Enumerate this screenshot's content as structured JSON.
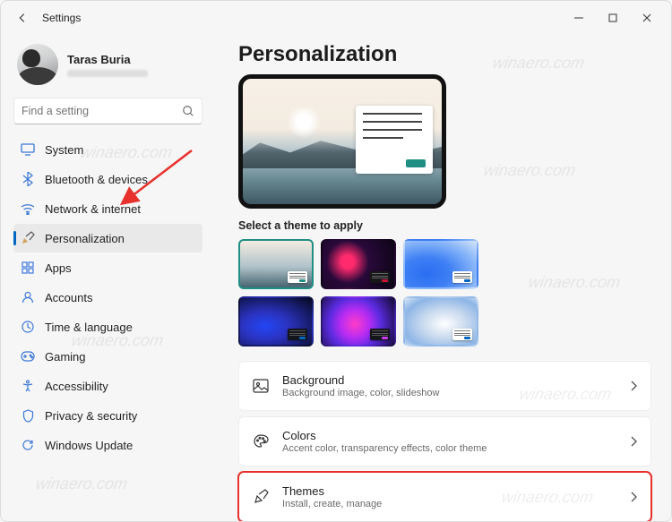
{
  "window": {
    "title": "Settings",
    "profile_name": "Taras Buria"
  },
  "search": {
    "placeholder": "Find a setting"
  },
  "nav": {
    "items": [
      {
        "id": "system",
        "label": "System"
      },
      {
        "id": "bluetooth",
        "label": "Bluetooth & devices"
      },
      {
        "id": "network",
        "label": "Network & internet"
      },
      {
        "id": "personalization",
        "label": "Personalization"
      },
      {
        "id": "apps",
        "label": "Apps"
      },
      {
        "id": "accounts",
        "label": "Accounts"
      },
      {
        "id": "time",
        "label": "Time & language"
      },
      {
        "id": "gaming",
        "label": "Gaming"
      },
      {
        "id": "accessibility",
        "label": "Accessibility"
      },
      {
        "id": "privacy",
        "label": "Privacy & security"
      },
      {
        "id": "update",
        "label": "Windows Update"
      }
    ]
  },
  "page": {
    "title": "Personalization",
    "theme_label": "Select a theme to apply"
  },
  "cards": {
    "background": {
      "title": "Background",
      "subtitle": "Background image, color, slideshow"
    },
    "colors": {
      "title": "Colors",
      "subtitle": "Accent color, transparency effects, color theme"
    },
    "themes": {
      "title": "Themes",
      "subtitle": "Install, create, manage"
    }
  },
  "watermark": "winaero.com"
}
